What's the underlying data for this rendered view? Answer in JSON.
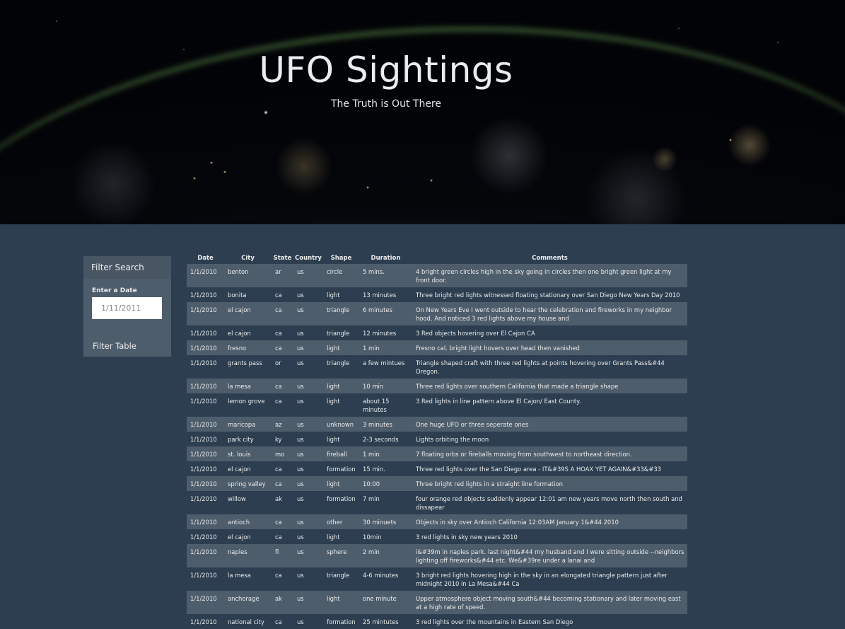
{
  "hero": {
    "title": "UFO Sightings",
    "subtitle": "The Truth is Out There"
  },
  "filter": {
    "heading": "Filter Search",
    "date_label": "Enter a Date",
    "date_placeholder": "1/11/2011",
    "button_label": "Filter Table"
  },
  "table": {
    "columns": [
      "Date",
      "City",
      "State",
      "Country",
      "Shape",
      "Duration",
      "Comments"
    ],
    "rows": [
      [
        "1/1/2010",
        "benton",
        "ar",
        "us",
        "circle",
        "5 mins.",
        "4 bright green circles high in the sky going in circles then one bright green light at my front door."
      ],
      [
        "1/1/2010",
        "bonita",
        "ca",
        "us",
        "light",
        "13 minutes",
        "Three bright red lights witnessed floating stationary over San Diego New Years Day 2010"
      ],
      [
        "1/1/2010",
        "el cajon",
        "ca",
        "us",
        "triangle",
        "6 minutes",
        "On New Years Eve I went outside to hear the celebration and fireworks in my neighbor hood. And noticed 3 red lights above my house and"
      ],
      [
        "1/1/2010",
        "el cajon",
        "ca",
        "us",
        "triangle",
        "12 minutes",
        "3 Red objects hovering over El Cajon CA"
      ],
      [
        "1/1/2010",
        "fresno",
        "ca",
        "us",
        "light",
        "1 min",
        "Fresno cal. bright light hovers over head then vanished"
      ],
      [
        "1/1/2010",
        "grants pass",
        "or",
        "us",
        "triangle",
        "a few mintues",
        "Triangle shaped craft with three red lights at points hovering over Grants Pass&#44 Oregon."
      ],
      [
        "1/1/2010",
        "la mesa",
        "ca",
        "us",
        "light",
        "10 min",
        "Three red lights over southern California that made a triangle shape"
      ],
      [
        "1/1/2010",
        "lemon grove",
        "ca",
        "us",
        "light",
        "about 15 minutes",
        "3 Red lights in line pattern above El Cajon/ East County."
      ],
      [
        "1/1/2010",
        "maricopa",
        "az",
        "us",
        "unknown",
        "3 minutes",
        "One huge UFO or three seperate ones"
      ],
      [
        "1/1/2010",
        "park city",
        "ky",
        "us",
        "light",
        "2-3 seconds",
        "Lights orbiting the moon"
      ],
      [
        "1/1/2010",
        "st. louis",
        "mo",
        "us",
        "fireball",
        "1 min",
        "7 floating orbs or fireballs moving from southwest to northeast direction."
      ],
      [
        "1/1/2010",
        "el cajon",
        "ca",
        "us",
        "formation",
        "15 min.",
        "Three red lights over the San Diego area - IT&#39S A HOAX YET AGAIN&#33&#33"
      ],
      [
        "1/1/2010",
        "spring valley",
        "ca",
        "us",
        "light",
        "10:00",
        "Three bright red lights in a straight line formation"
      ],
      [
        "1/1/2010",
        "willow",
        "ak",
        "us",
        "formation",
        "7 min",
        "four orange red objects suddenly appear 12:01 am new years move north then south and dissapear"
      ],
      [
        "1/1/2010",
        "antioch",
        "ca",
        "us",
        "other",
        "30 minuets",
        "Objects in sky over Antioch California 12:03AM January 1&#44 2010"
      ],
      [
        "1/1/2010",
        "el cajon",
        "ca",
        "us",
        "light",
        "10min",
        "3 red lights in sky new years 2010"
      ],
      [
        "1/1/2010",
        "naples",
        "fl",
        "us",
        "sphere",
        "2 min",
        "i&#39m in naples park. last night&#44 my husband and I were sitting outside --neighbors lighting off fireworks&#44 etc. We&#39re under a lanai and"
      ],
      [
        "1/1/2010",
        "la mesa",
        "ca",
        "us",
        "triangle",
        "4-6 minutes",
        "3 bright red lights hovering high in the sky in an elongated triangle pattern just after midnight 2010 in La Mesa&#44 Ca"
      ],
      [
        "1/1/2010",
        "anchorage",
        "ak",
        "us",
        "light",
        "one minute",
        "Upper atmosphere object moving south&#44 becoming stationary and later moving east at a high rate of speed."
      ],
      [
        "1/1/2010",
        "national city",
        "ca",
        "us",
        "formation",
        "25 mintutes",
        "3 red lights over the mountains in Eastern San Diego"
      ]
    ]
  }
}
